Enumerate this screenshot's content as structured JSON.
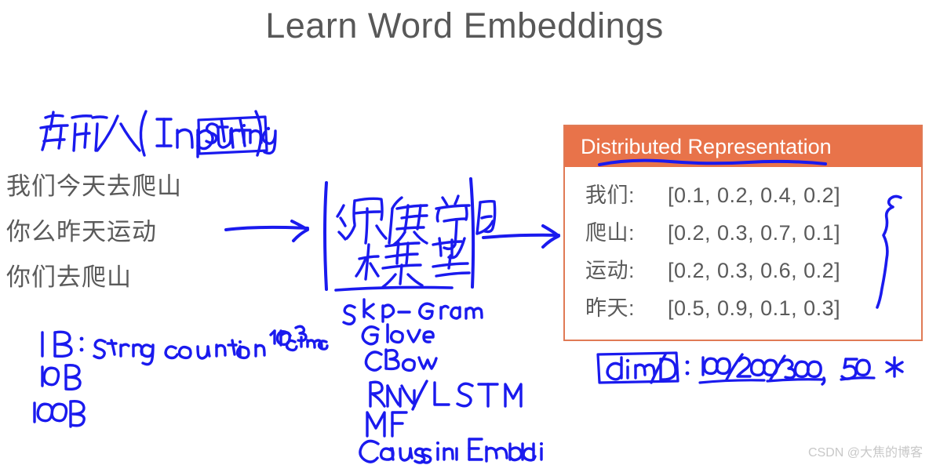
{
  "slide": {
    "title": "Learn Word Embeddings",
    "background_color": "#ffffff",
    "title_color": "#585858",
    "ink_color": "#1a1aee",
    "accent_color": "#e8734a"
  },
  "input_section": {
    "handwritten_label": "输入(Input)：String",
    "handwritten_label_parts": {
      "prefix": "输入(Input):",
      "boxed_token": "String"
    },
    "sentences": [
      "我们今天去爬山",
      "你么昨天运动",
      "你们去爬山"
    ],
    "scale_notes": [
      "1B: strng contains 10⁹ tokens",
      "10B",
      "100B"
    ]
  },
  "model_section": {
    "boxed_handwritten": [
      "深度学习",
      "模型"
    ],
    "model_list": [
      "Skip- Gram",
      "Glove",
      "CBow",
      "RNN/ LSTM",
      "MF",
      "Gaussian Embedding"
    ]
  },
  "distributed_representation": {
    "header": "Distributed Representation",
    "header_bg": "#e8734a",
    "header_text_color": "#ffffff",
    "border_color": "#e07a55",
    "rows": [
      {
        "word": "我们:",
        "vector": "[0.1, 0.2, 0.4, 0.2]"
      },
      {
        "word": "爬山:",
        "vector": "[0.2, 0.3, 0.7, 0.1]"
      },
      {
        "word": "运动:",
        "vector": "[0.2, 0.3, 0.6, 0.2]"
      },
      {
        "word": "昨天:",
        "vector": "[0.5, 0.9, 0.1, 0.3]"
      }
    ],
    "dimension_note": {
      "boxed_token": "dim/D",
      "separator": ":",
      "values": "100/200/300,",
      "extra": "50",
      "star": "*"
    }
  },
  "watermark": "CSDN @大焦的博客"
}
